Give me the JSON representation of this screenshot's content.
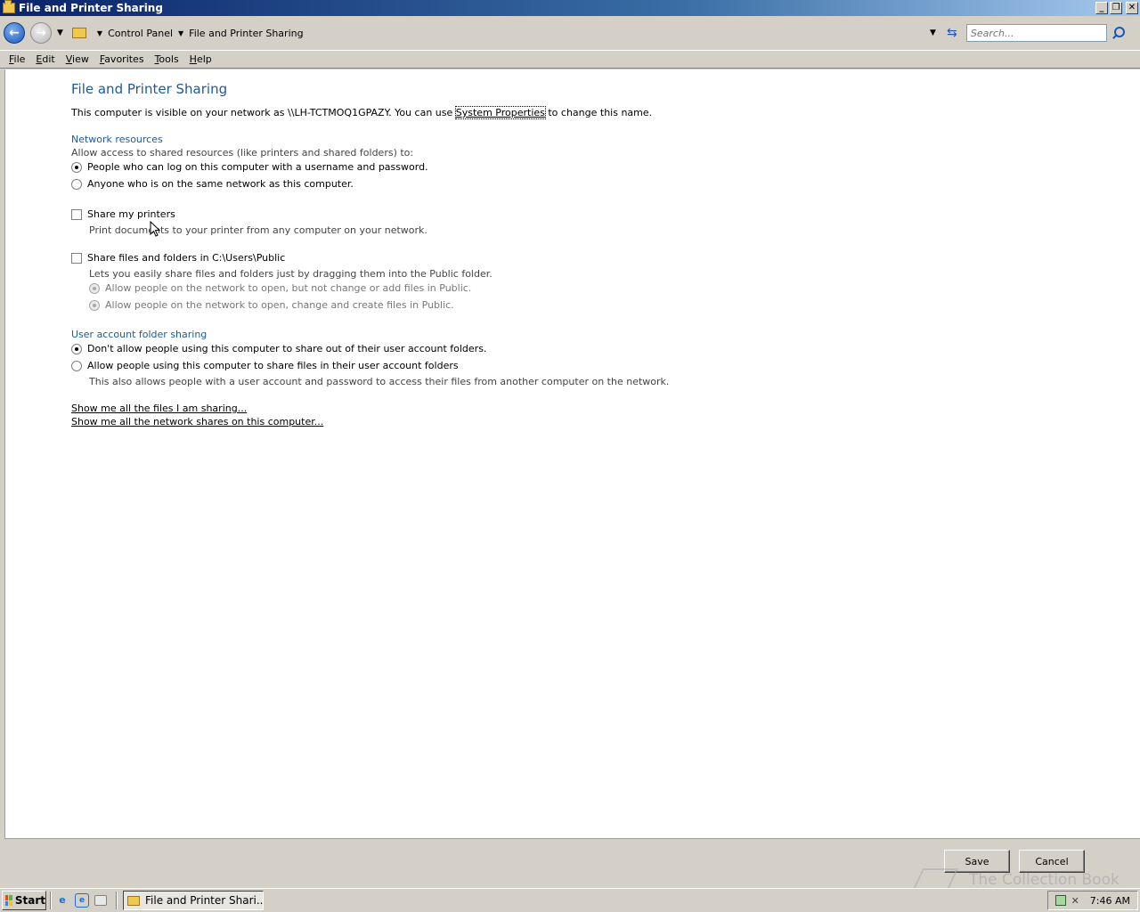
{
  "window": {
    "title": "File and Printer Sharing",
    "buttons": {
      "minimize": "_",
      "restore": "❐",
      "close": "✕"
    }
  },
  "addressbar": {
    "crumbs": [
      "Control Panel",
      "File and Printer Sharing"
    ],
    "search_placeholder": "Search..."
  },
  "menu": [
    {
      "label": "File",
      "acc": "F",
      "rest": "ile"
    },
    {
      "label": "Edit",
      "acc": "E",
      "rest": "dit"
    },
    {
      "label": "View",
      "acc": "V",
      "rest": "iew"
    },
    {
      "label": "Favorites",
      "acc": "F",
      "rest": "avorites"
    },
    {
      "label": "Tools",
      "acc": "T",
      "rest": "ools"
    },
    {
      "label": "Help",
      "acc": "H",
      "rest": "elp"
    }
  ],
  "page": {
    "title": "File and Printer Sharing",
    "intro_before": "This computer is visible on your network as \\\\LH-TCTMOQ1GPAZY.  You can use ",
    "intro_link": "System Properties",
    "intro_after": " to change this name.",
    "network_resources": {
      "heading": "Network resources",
      "prompt": "Allow access to shared resources (like printers and shared folders) to:",
      "option_login": "People who can log on this computer with a username and password.",
      "option_anyone": "Anyone who is on the same network as this computer."
    },
    "share_printers": {
      "label": "Share my printers",
      "description": "Print documents to your printer from any computer on your network."
    },
    "share_public": {
      "label": "Share files and folders in C:\\Users\\Public",
      "description": "Lets you easily share files and folders just by dragging them into the Public folder.",
      "option_readonly": "Allow people on the network to open, but not change or add files in Public.",
      "option_full": "Allow people on the network to open, change and create files in Public."
    },
    "user_account_sharing": {
      "heading": "User account folder sharing",
      "option_dont_allow": "Don't allow people using this computer to share out of their user account folders.",
      "option_allow": "Allow people using this computer to share files in their user account folders",
      "description": "This also allows people with a user account and password to access their files from another computer on the network."
    },
    "links": {
      "files_sharing": "Show me all the files I am sharing...",
      "network_shares": "Show me all the network shares on this computer..."
    }
  },
  "buttons": {
    "save": "Save",
    "cancel": "Cancel"
  },
  "taskbar": {
    "start": "Start",
    "task": "File and Printer Shari...",
    "clock": "7:46 AM",
    "watermark": "The Collection Book"
  }
}
